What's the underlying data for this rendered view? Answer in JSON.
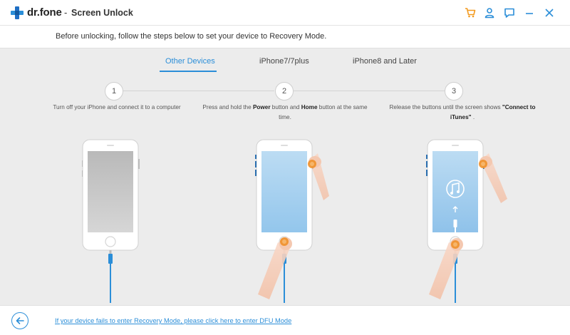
{
  "app": {
    "name": "dr.fone",
    "separator": "-",
    "module": "Screen Unlock"
  },
  "titlebar": {
    "icons": [
      "cart-icon",
      "user-icon",
      "feedback-icon",
      "minimize-icon",
      "close-icon"
    ],
    "accent_color": "#f39a1e"
  },
  "instruction": "Before unlocking, follow the steps below to set your device to Recovery Mode.",
  "tabs": [
    {
      "label": "Other Devices",
      "active": true
    },
    {
      "label": "iPhone7/7plus",
      "active": false
    },
    {
      "label": "iPhone8 and Later",
      "active": false
    }
  ],
  "steps": [
    {
      "number": "1",
      "text": "Turn off your iPhone and connect it to a computer"
    },
    {
      "number": "2",
      "text_1": "Press and hold the ",
      "bold_1": "Power",
      "text_2": " button and ",
      "bold_2": "Home",
      "text_3": " button at the same time."
    },
    {
      "number": "3",
      "text_1": "Release the buttons until the screen shows ",
      "bold_1": "\"Connect to iTunes\"",
      "text_2": " ."
    }
  ],
  "footer": {
    "dfu_link": "If your device fails to enter Recovery Mode, please click here to enter DFU Mode"
  },
  "colors": {
    "accent": "#2b8ed8",
    "brand": "#2b8ed8",
    "press_highlight": "#f0902a"
  }
}
